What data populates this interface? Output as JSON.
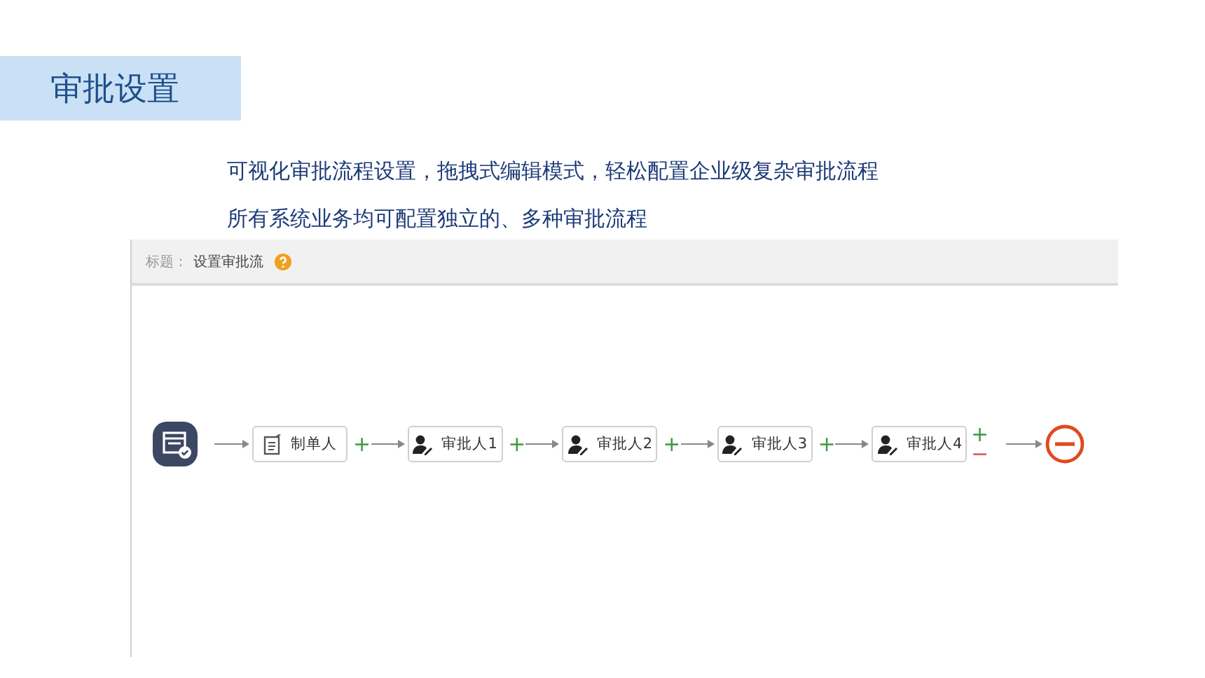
{
  "slide_title": "审批设置",
  "bullets": [
    "可视化审批流程设置，拖拽式编辑模式，轻松配置企业级复杂审批流程",
    "所有系统业务均可配置独立的、多种审批流程"
  ],
  "panel": {
    "title_label": "标题：",
    "title_value": "设置审批流"
  },
  "flow": {
    "nodes": [
      {
        "kind": "creator",
        "label": "制单人",
        "add": "+"
      },
      {
        "kind": "approver",
        "label": "审批人1",
        "add": "+"
      },
      {
        "kind": "approver",
        "label": "审批人2",
        "add": "+"
      },
      {
        "kind": "approver",
        "label": "审批人3",
        "add": "+"
      },
      {
        "kind": "approver",
        "label": "审批人4",
        "add": "+",
        "remove": "−"
      }
    ]
  }
}
